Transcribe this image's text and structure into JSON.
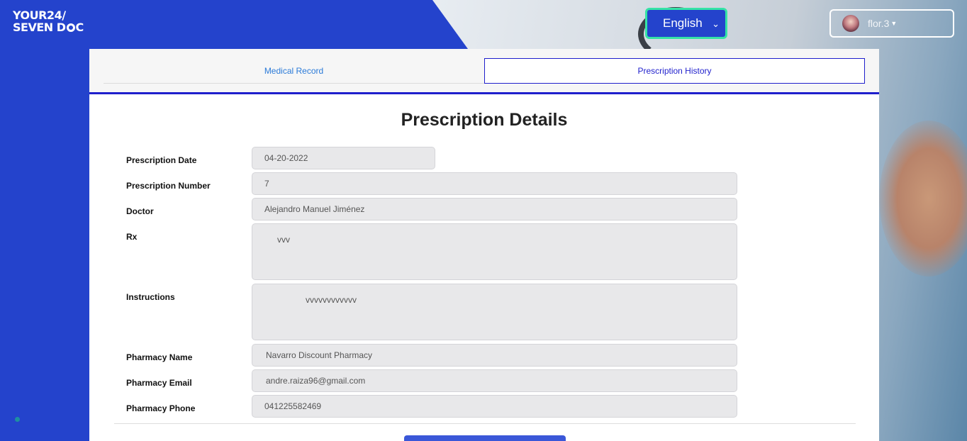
{
  "header": {
    "logo_line1": "YOUR24/",
    "logo_line2a": "SEVEN D",
    "logo_line2b": "C",
    "language": "English",
    "user_name": "flor.3"
  },
  "tabs": {
    "medical_record": "Medical Record",
    "prescription_history": "Prescription History",
    "active": "prescription_history"
  },
  "page_title": "Prescription Details",
  "fields": {
    "prescription_date": {
      "label": "Prescription Date",
      "value": "04-20-2022"
    },
    "prescription_number": {
      "label": "Prescription Number",
      "value": "7"
    },
    "doctor": {
      "label": "Doctor",
      "value": "Alejandro Manuel Jiménez"
    },
    "rx": {
      "label": "Rx",
      "value": "vvv"
    },
    "instructions": {
      "label": "Instructions",
      "value": "vvvvvvvvvvvv"
    },
    "pharmacy_name": {
      "label": "Pharmacy Name",
      "value": "Navarro Discount Pharmacy"
    },
    "pharmacy_email": {
      "label": "Pharmacy Email",
      "value": "andre.raiza96@gmail.com"
    },
    "pharmacy_phone": {
      "label": "Pharmacy Phone",
      "value": "041225582469"
    }
  },
  "colors": {
    "brand_blue": "#2443cc",
    "accent_green": "#35e3a6",
    "tab_active": "#1f1fcc",
    "tab_link": "#2a7ad8"
  }
}
